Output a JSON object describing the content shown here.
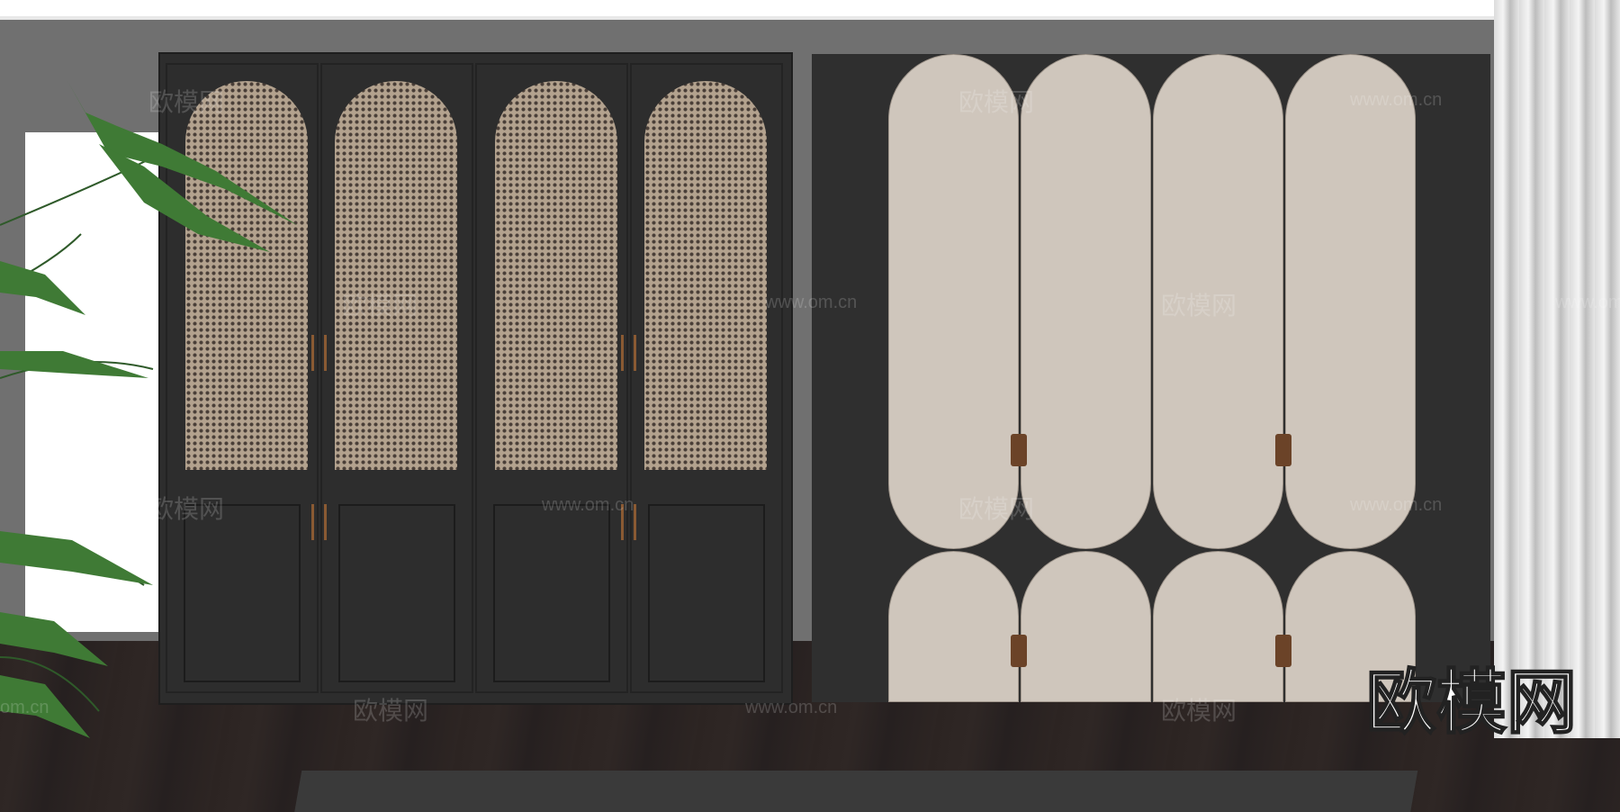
{
  "scene": {
    "brand_logo": "欧模网",
    "watermark_cn": "欧模网",
    "watermark_url": "www.om.cn",
    "watermark_partial_url": "om.cn"
  },
  "colors": {
    "wall": "#707070",
    "cabinet_dark": "#2d2d2d",
    "door_cream": "#cfc6bc",
    "rattan": "#b3a28e",
    "handle": "#8a5a33",
    "floor": "#2c2422"
  }
}
